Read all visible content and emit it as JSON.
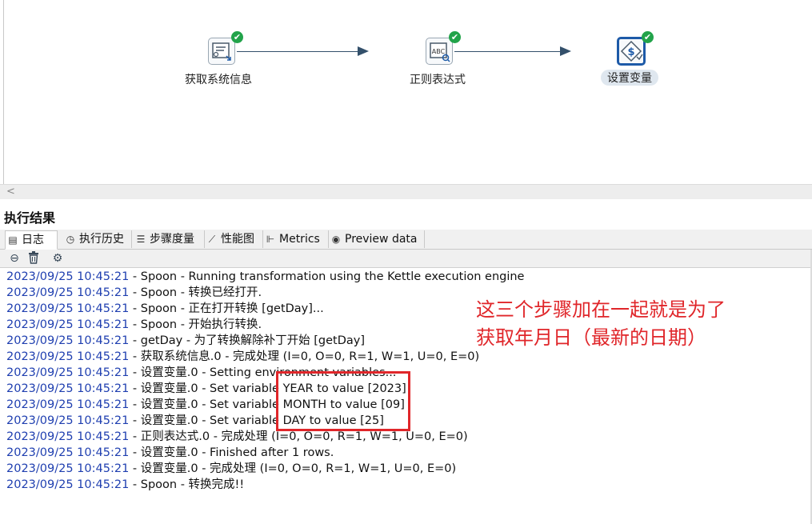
{
  "canvas": {
    "steps": [
      {
        "label": "获取系统信息",
        "icon": "system-info-icon",
        "status": "success"
      },
      {
        "label": "正则表达式",
        "icon": "regex-abc-icon",
        "status": "success"
      },
      {
        "label": "设置变量",
        "icon": "set-variables-icon",
        "status": "success",
        "selected": true
      }
    ],
    "success_glyph": "✔"
  },
  "results_panel": {
    "title": "执行结果",
    "tabs": [
      {
        "label": "日志",
        "icon": "log-icon",
        "active": true
      },
      {
        "label": "执行历史",
        "icon": "history-icon"
      },
      {
        "label": "步骤度量",
        "icon": "step-metrics-icon"
      },
      {
        "label": "性能图",
        "icon": "performance-chart-icon"
      },
      {
        "label": "Metrics",
        "icon": "metrics-icon"
      },
      {
        "label": "Preview data",
        "icon": "eye-icon"
      }
    ],
    "toolbar": [
      {
        "icon": "stop-icon"
      },
      {
        "icon": "trash-icon"
      },
      {
        "icon": "settings-icon"
      }
    ]
  },
  "log_lines": [
    {
      "ts": "2023/09/25 10:45:21",
      "msg": " - Spoon - Running transformation using the Kettle execution engine"
    },
    {
      "ts": "2023/09/25 10:45:21",
      "msg": " - Spoon - 转换已经打开."
    },
    {
      "ts": "2023/09/25 10:45:21",
      "msg": " - Spoon - 正在打开转换 [getDay]..."
    },
    {
      "ts": "2023/09/25 10:45:21",
      "msg": " - Spoon - 开始执行转换."
    },
    {
      "ts": "2023/09/25 10:45:21",
      "msg": " - getDay - 为了转换解除补丁开始  [getDay]"
    },
    {
      "ts": "2023/09/25 10:45:21",
      "msg": " - 获取系统信息.0 - 完成处理 (I=0, O=0, R=1, W=1, U=0, E=0)"
    },
    {
      "ts": "2023/09/25 10:45:21",
      "msg": " - 设置变量.0 - Setting environment variables..."
    },
    {
      "ts": "2023/09/25 10:45:21",
      "msg": " - 设置变量.0 - Set variable YEAR to value [2023]"
    },
    {
      "ts": "2023/09/25 10:45:21",
      "msg": " - 设置变量.0 - Set variable MONTH to value [09]"
    },
    {
      "ts": "2023/09/25 10:45:21",
      "msg": " - 设置变量.0 - Set variable DAY to value [25]"
    },
    {
      "ts": "2023/09/25 10:45:21",
      "msg": " - 正则表达式.0 - 完成处理 (I=0, O=0, R=1, W=1, U=0, E=0)"
    },
    {
      "ts": "2023/09/25 10:45:21",
      "msg": " - 设置变量.0 - Finished after 1 rows."
    },
    {
      "ts": "2023/09/25 10:45:21",
      "msg": " - 设置变量.0 - 完成处理 (I=0, O=0, R=1, W=1, U=0, E=0)"
    },
    {
      "ts": "2023/09/25 10:45:21",
      "msg": " - Spoon - 转换完成!!"
    }
  ],
  "annotation": {
    "line1": "这三个步骤加在一起就是为了",
    "line2": "获取年月日（最新的日期）",
    "color": "#e0262a"
  },
  "scroll_left_glyph": "<"
}
